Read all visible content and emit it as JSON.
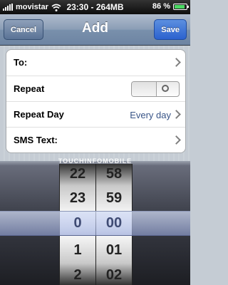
{
  "status_bar": {
    "carrier": "movistar",
    "time": "23:30",
    "memory": "264MB",
    "battery_percent": "86 %",
    "battery_level": 0.86,
    "icons": [
      "signal-bars-icon",
      "wifi-icon",
      "battery-icon"
    ]
  },
  "navbar": {
    "title": "Add",
    "cancel_label": "Cancel",
    "save_label": "Save"
  },
  "form": {
    "rows": [
      {
        "label": "To:",
        "detail": ""
      },
      {
        "label": "Repeat",
        "toggle_on": false
      },
      {
        "label": "Repeat Day",
        "detail": "Every day"
      },
      {
        "label": "SMS Text:",
        "detail": ""
      }
    ]
  },
  "picker": {
    "watermark": "TOUCHINFOMOBILE",
    "hours": [
      "22",
      "23",
      "0",
      "1",
      "2"
    ],
    "minutes": [
      "58",
      "59",
      "00",
      "01",
      "02"
    ],
    "selected_hour": "0",
    "selected_minute": "00"
  },
  "colors": {
    "accent": "#2b62cf",
    "detail_text": "#385487",
    "battery_fill": "#4cd964"
  }
}
